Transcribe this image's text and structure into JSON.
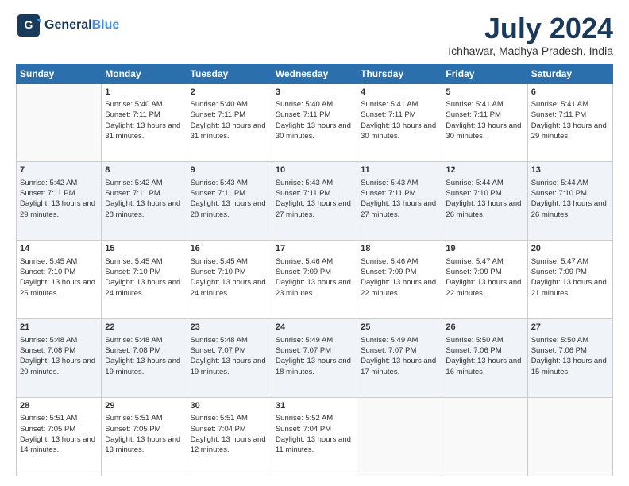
{
  "logo": {
    "line1": "General",
    "line2": "Blue",
    "icon": "▶"
  },
  "header": {
    "title": "July 2024",
    "subtitle": "Ichhawar, Madhya Pradesh, India"
  },
  "days": [
    "Sunday",
    "Monday",
    "Tuesday",
    "Wednesday",
    "Thursday",
    "Friday",
    "Saturday"
  ],
  "weeks": [
    [
      {
        "num": "",
        "sunrise": "",
        "sunset": "",
        "daylight": ""
      },
      {
        "num": "1",
        "sunrise": "Sunrise: 5:40 AM",
        "sunset": "Sunset: 7:11 PM",
        "daylight": "Daylight: 13 hours and 31 minutes."
      },
      {
        "num": "2",
        "sunrise": "Sunrise: 5:40 AM",
        "sunset": "Sunset: 7:11 PM",
        "daylight": "Daylight: 13 hours and 31 minutes."
      },
      {
        "num": "3",
        "sunrise": "Sunrise: 5:40 AM",
        "sunset": "Sunset: 7:11 PM",
        "daylight": "Daylight: 13 hours and 30 minutes."
      },
      {
        "num": "4",
        "sunrise": "Sunrise: 5:41 AM",
        "sunset": "Sunset: 7:11 PM",
        "daylight": "Daylight: 13 hours and 30 minutes."
      },
      {
        "num": "5",
        "sunrise": "Sunrise: 5:41 AM",
        "sunset": "Sunset: 7:11 PM",
        "daylight": "Daylight: 13 hours and 30 minutes."
      },
      {
        "num": "6",
        "sunrise": "Sunrise: 5:41 AM",
        "sunset": "Sunset: 7:11 PM",
        "daylight": "Daylight: 13 hours and 29 minutes."
      }
    ],
    [
      {
        "num": "7",
        "sunrise": "Sunrise: 5:42 AM",
        "sunset": "Sunset: 7:11 PM",
        "daylight": "Daylight: 13 hours and 29 minutes."
      },
      {
        "num": "8",
        "sunrise": "Sunrise: 5:42 AM",
        "sunset": "Sunset: 7:11 PM",
        "daylight": "Daylight: 13 hours and 28 minutes."
      },
      {
        "num": "9",
        "sunrise": "Sunrise: 5:43 AM",
        "sunset": "Sunset: 7:11 PM",
        "daylight": "Daylight: 13 hours and 28 minutes."
      },
      {
        "num": "10",
        "sunrise": "Sunrise: 5:43 AM",
        "sunset": "Sunset: 7:11 PM",
        "daylight": "Daylight: 13 hours and 27 minutes."
      },
      {
        "num": "11",
        "sunrise": "Sunrise: 5:43 AM",
        "sunset": "Sunset: 7:11 PM",
        "daylight": "Daylight: 13 hours and 27 minutes."
      },
      {
        "num": "12",
        "sunrise": "Sunrise: 5:44 AM",
        "sunset": "Sunset: 7:10 PM",
        "daylight": "Daylight: 13 hours and 26 minutes."
      },
      {
        "num": "13",
        "sunrise": "Sunrise: 5:44 AM",
        "sunset": "Sunset: 7:10 PM",
        "daylight": "Daylight: 13 hours and 26 minutes."
      }
    ],
    [
      {
        "num": "14",
        "sunrise": "Sunrise: 5:45 AM",
        "sunset": "Sunset: 7:10 PM",
        "daylight": "Daylight: 13 hours and 25 minutes."
      },
      {
        "num": "15",
        "sunrise": "Sunrise: 5:45 AM",
        "sunset": "Sunset: 7:10 PM",
        "daylight": "Daylight: 13 hours and 24 minutes."
      },
      {
        "num": "16",
        "sunrise": "Sunrise: 5:45 AM",
        "sunset": "Sunset: 7:10 PM",
        "daylight": "Daylight: 13 hours and 24 minutes."
      },
      {
        "num": "17",
        "sunrise": "Sunrise: 5:46 AM",
        "sunset": "Sunset: 7:09 PM",
        "daylight": "Daylight: 13 hours and 23 minutes."
      },
      {
        "num": "18",
        "sunrise": "Sunrise: 5:46 AM",
        "sunset": "Sunset: 7:09 PM",
        "daylight": "Daylight: 13 hours and 22 minutes."
      },
      {
        "num": "19",
        "sunrise": "Sunrise: 5:47 AM",
        "sunset": "Sunset: 7:09 PM",
        "daylight": "Daylight: 13 hours and 22 minutes."
      },
      {
        "num": "20",
        "sunrise": "Sunrise: 5:47 AM",
        "sunset": "Sunset: 7:09 PM",
        "daylight": "Daylight: 13 hours and 21 minutes."
      }
    ],
    [
      {
        "num": "21",
        "sunrise": "Sunrise: 5:48 AM",
        "sunset": "Sunset: 7:08 PM",
        "daylight": "Daylight: 13 hours and 20 minutes."
      },
      {
        "num": "22",
        "sunrise": "Sunrise: 5:48 AM",
        "sunset": "Sunset: 7:08 PM",
        "daylight": "Daylight: 13 hours and 19 minutes."
      },
      {
        "num": "23",
        "sunrise": "Sunrise: 5:48 AM",
        "sunset": "Sunset: 7:07 PM",
        "daylight": "Daylight: 13 hours and 19 minutes."
      },
      {
        "num": "24",
        "sunrise": "Sunrise: 5:49 AM",
        "sunset": "Sunset: 7:07 PM",
        "daylight": "Daylight: 13 hours and 18 minutes."
      },
      {
        "num": "25",
        "sunrise": "Sunrise: 5:49 AM",
        "sunset": "Sunset: 7:07 PM",
        "daylight": "Daylight: 13 hours and 17 minutes."
      },
      {
        "num": "26",
        "sunrise": "Sunrise: 5:50 AM",
        "sunset": "Sunset: 7:06 PM",
        "daylight": "Daylight: 13 hours and 16 minutes."
      },
      {
        "num": "27",
        "sunrise": "Sunrise: 5:50 AM",
        "sunset": "Sunset: 7:06 PM",
        "daylight": "Daylight: 13 hours and 15 minutes."
      }
    ],
    [
      {
        "num": "28",
        "sunrise": "Sunrise: 5:51 AM",
        "sunset": "Sunset: 7:05 PM",
        "daylight": "Daylight: 13 hours and 14 minutes."
      },
      {
        "num": "29",
        "sunrise": "Sunrise: 5:51 AM",
        "sunset": "Sunset: 7:05 PM",
        "daylight": "Daylight: 13 hours and 13 minutes."
      },
      {
        "num": "30",
        "sunrise": "Sunrise: 5:51 AM",
        "sunset": "Sunset: 7:04 PM",
        "daylight": "Daylight: 13 hours and 12 minutes."
      },
      {
        "num": "31",
        "sunrise": "Sunrise: 5:52 AM",
        "sunset": "Sunset: 7:04 PM",
        "daylight": "Daylight: 13 hours and 11 minutes."
      },
      {
        "num": "",
        "sunrise": "",
        "sunset": "",
        "daylight": ""
      },
      {
        "num": "",
        "sunrise": "",
        "sunset": "",
        "daylight": ""
      },
      {
        "num": "",
        "sunrise": "",
        "sunset": "",
        "daylight": ""
      }
    ]
  ]
}
